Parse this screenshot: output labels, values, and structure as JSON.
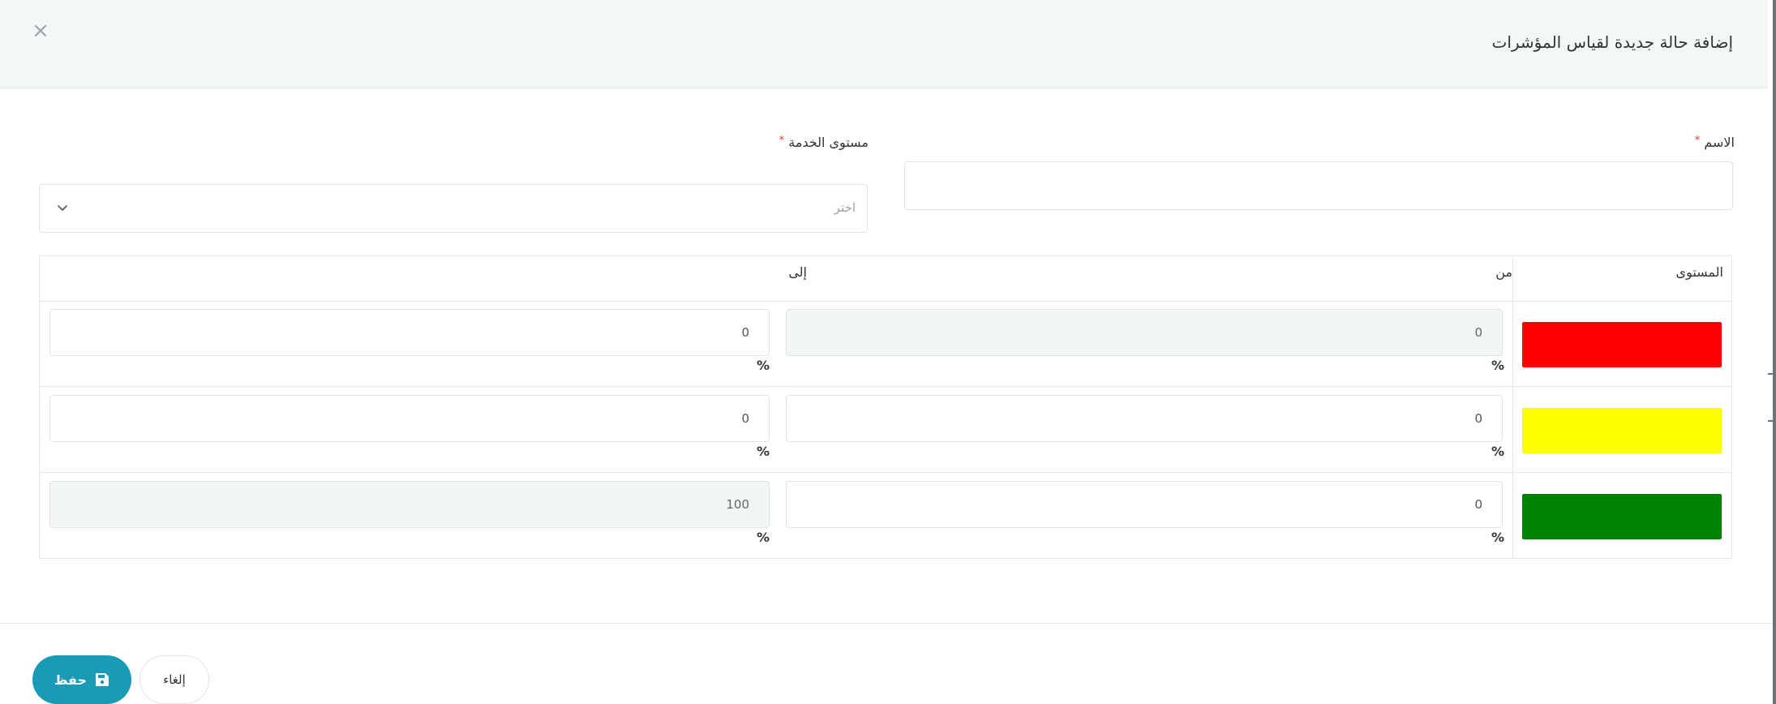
{
  "modal": {
    "title": "إضافة حالة جديدة لقياس المؤشرات",
    "close_symbol": "×"
  },
  "form": {
    "name_label": "الاسم",
    "name_value": "",
    "service_level_label": "مستوى الخدمة",
    "service_level_placeholder": "اختر",
    "required_mark": "*"
  },
  "levels_table": {
    "headers": {
      "level": "المستوى",
      "from": "من",
      "to": "إلى"
    },
    "unit_symbol": "%",
    "rows": [
      {
        "color": "#ff0000",
        "from": "0",
        "to": "0",
        "from_disabled": true,
        "to_disabled": false
      },
      {
        "color": "#ffff00",
        "from": "0",
        "to": "0",
        "from_disabled": false,
        "to_disabled": false
      },
      {
        "color": "#008000",
        "from": "0",
        "to": "100",
        "from_disabled": false,
        "to_disabled": true
      }
    ]
  },
  "footer": {
    "save_label": "حفظ",
    "cancel_label": "إلغاء"
  },
  "colors": {
    "header_bg": "#f3f7f8",
    "primary": "#1a9bb5",
    "required": "#e53935",
    "disabled_input_bg": "#f3f6f7"
  },
  "icons": {
    "close": "close-icon",
    "chevron": "chevron-down-icon",
    "save": "floppy-disk-icon",
    "percent": "percent-icon"
  }
}
